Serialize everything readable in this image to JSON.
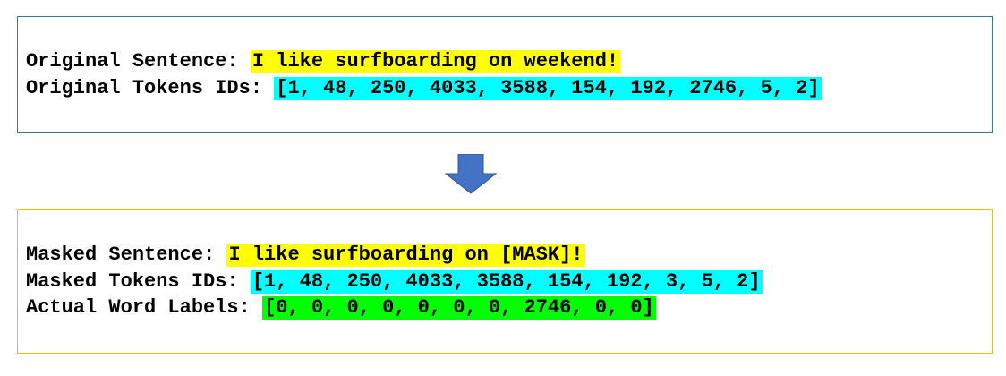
{
  "original": {
    "sentence_label": "Original Sentence: ",
    "sentence_value": "I like surfboarding on weekend!",
    "tokens_label": "Original Tokens IDs: ",
    "tokens_value": "[1, 48, 250, 4033, 3588, 154, 192, 2746, 5, 2]"
  },
  "masked": {
    "sentence_label": "Masked Sentence: ",
    "sentence_value": "I like surfboarding on [MASK]!",
    "tokens_label": "Masked Tokens IDs: ",
    "tokens_value": "[1, 48, 250, 4033, 3588, 154, 192, 3, 5, 2]",
    "labels_label": "Actual Word Labels: ",
    "labels_value": "[0, 0, 0, 0, 0, 0, 0, 2746, 0, 0]"
  },
  "colors": {
    "sentence_highlight": "#ffff00",
    "tokens_highlight": "#00ffff",
    "labels_highlight": "#00ff00",
    "arrow": "#4472c4",
    "top_box_border": "#2e7f8c",
    "bottom_box_border": "#e3c21c"
  }
}
